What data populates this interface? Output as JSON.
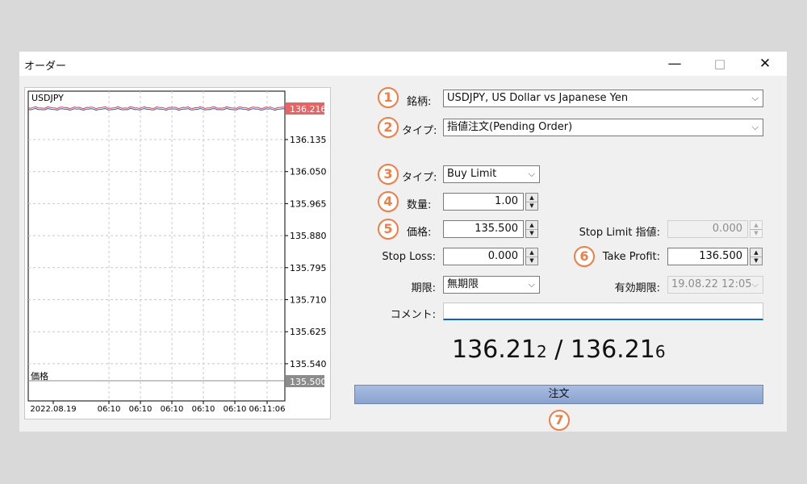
{
  "window": {
    "title": "オーダー",
    "minimize_icon": "—",
    "maximize_icon": "□",
    "close_icon": "✕"
  },
  "chart": {
    "symbol": "USDJPY",
    "price_labels": [
      "136.135",
      "136.050",
      "135.965",
      "135.880",
      "135.795",
      "135.710",
      "135.625",
      "135.540"
    ],
    "current_price": "136.216",
    "line_label": "価格",
    "line_price": "135.500",
    "time_labels": [
      "2022.08.19",
      "06:10",
      "06:10",
      "06:10",
      "06:10",
      "06:10",
      "06:11:06"
    ],
    "colors": {
      "bid": "#e04040",
      "ask": "#3050d0",
      "price_tag": "#e86464",
      "line_tag": "#8c8c8c"
    }
  },
  "markers": [
    "1",
    "2",
    "3",
    "4",
    "5",
    "6",
    "7"
  ],
  "form": {
    "symbol": {
      "label": "銘柄:",
      "value": "USDJPY, US Dollar vs Japanese Yen"
    },
    "order_kind": {
      "label": "タイプ:",
      "value": "指値注文(Pending Order)"
    },
    "type": {
      "label": "タイプ:",
      "value": "Buy Limit"
    },
    "volume": {
      "label": "数量:",
      "value": "1.00"
    },
    "price": {
      "label": "価格:",
      "value": "135.500"
    },
    "stop_limit": {
      "label": "Stop Limit 指値:",
      "value": "0.000"
    },
    "stop_loss": {
      "label": "Stop Loss:",
      "value": "0.000"
    },
    "take_profit": {
      "label": "Take Profit:",
      "value": "136.500"
    },
    "expiration": {
      "label": "期限:",
      "value": "無期限"
    },
    "expiry_date": {
      "label": "有効期限:",
      "value": "19.08.22 12:05"
    },
    "comment": {
      "label": "コメント:",
      "value": ""
    }
  },
  "quote": {
    "bid_main": "136.21",
    "bid_last": "2",
    "separator": " / ",
    "ask_main": "136.21",
    "ask_last": "6"
  },
  "order_button": {
    "label": "注文"
  }
}
